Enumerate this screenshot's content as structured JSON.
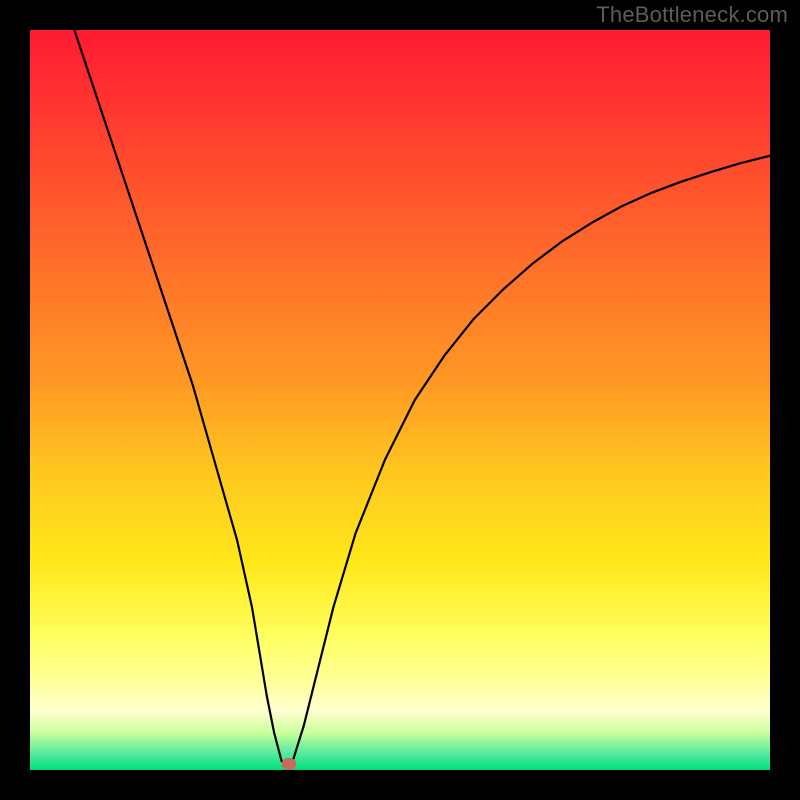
{
  "watermark": "TheBottleneck.com",
  "chart_data": {
    "type": "line",
    "title": "",
    "xlabel": "",
    "ylabel": "",
    "xlim": [
      0,
      100
    ],
    "ylim": [
      0,
      100
    ],
    "series": [
      {
        "name": "curve",
        "x": [
          6,
          10,
          14,
          18,
          22,
          24,
          26,
          28,
          30,
          31,
          32,
          33,
          34,
          35,
          34.5,
          35.5,
          37,
          39,
          41,
          44,
          48,
          52,
          56,
          60,
          64,
          68,
          72,
          76,
          80,
          84,
          88,
          92,
          96,
          100
        ],
        "values": [
          100,
          88,
          76,
          64,
          52,
          45,
          38,
          31,
          22,
          16,
          10,
          5,
          1.2,
          0.8,
          0.8,
          1.2,
          6,
          14,
          22,
          32,
          42,
          50,
          56,
          61,
          65,
          68.5,
          71.5,
          74,
          76.2,
          78,
          79.5,
          80.8,
          82,
          83
        ]
      }
    ],
    "marker": {
      "x": 35,
      "y": 0.8
    },
    "background_gradient": {
      "top": "#ff1a33",
      "bottom": "#00e080"
    }
  }
}
